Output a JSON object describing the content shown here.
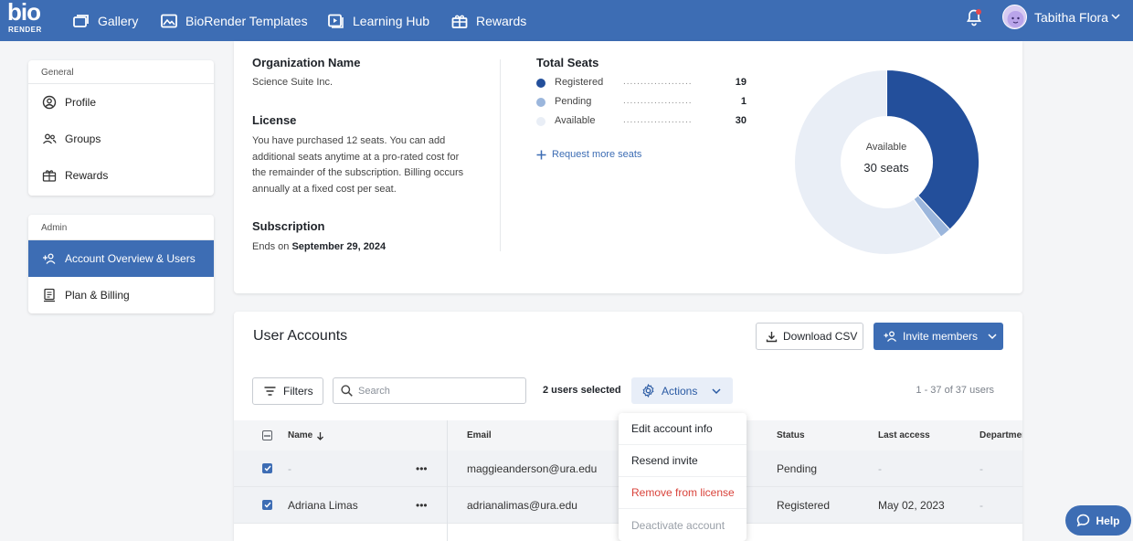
{
  "brand": {
    "logo_top": "bio",
    "logo_bottom": "RENDER"
  },
  "nav": {
    "items": [
      {
        "label": "Gallery",
        "icon": "gallery-icon"
      },
      {
        "label": "BioRender Templates",
        "icon": "image-icon"
      },
      {
        "label": "Learning Hub",
        "icon": "play-icon"
      },
      {
        "label": "Rewards",
        "icon": "gift-icon"
      }
    ],
    "user_name": "Tabitha Flora"
  },
  "sidebar": {
    "general": {
      "heading": "General",
      "items": [
        {
          "label": "Profile",
          "icon": "user-circle-icon"
        },
        {
          "label": "Groups",
          "icon": "groups-icon"
        },
        {
          "label": "Rewards",
          "icon": "gift-icon"
        }
      ]
    },
    "admin": {
      "heading": "Admin",
      "items": [
        {
          "label": "Account Overview & Users",
          "icon": "add-user-icon",
          "active": true
        },
        {
          "label": "Plan & Billing",
          "icon": "billing-icon"
        }
      ]
    }
  },
  "overview": {
    "org_heading": "Organization Name",
    "org_name": "Science Suite Inc.",
    "license_heading": "License",
    "license_text": "You have purchased 12 seats. You can add additional seats anytime at a pro-rated cost for the remainder of the subscription. Billing occurs annually at a fixed cost per seat.",
    "subscription_heading": "Subscription",
    "subscription_prefix": "Ends on",
    "subscription_date": "September 29, 2024",
    "seats_heading": "Total Seats",
    "seats": [
      {
        "label": "Registered",
        "value": 19,
        "color": "#234f9b"
      },
      {
        "label": "Pending",
        "value": 1,
        "color": "#9bb6dc"
      },
      {
        "label": "Available",
        "value": 30,
        "color": "#e9eef6"
      }
    ],
    "dot_leader": "....................",
    "request_label": "Request more seats",
    "donut_label": "Available",
    "donut_value": "30 seats"
  },
  "users": {
    "title": "User Accounts",
    "download_label": "Download CSV",
    "invite_label": "Invite members",
    "filters_label": "Filters",
    "search_placeholder": "Search",
    "selected_text": "2 users selected",
    "actions_label": "Actions",
    "range_text": "1 - 37 of 37 users",
    "columns": {
      "name": "Name",
      "email": "Email",
      "status": "Status",
      "last_access": "Last access",
      "department": "Departmen"
    },
    "rows": [
      {
        "name": "-",
        "email": "maggieanderson@ura.edu",
        "status": "Pending",
        "last_access": "-",
        "department": "-",
        "checked": true
      },
      {
        "name": "Adriana Limas",
        "email": "adrianalimas@ura.edu",
        "status": "Registered",
        "last_access": "May 02, 2023",
        "department": "-",
        "checked": true
      }
    ],
    "row_menu_glyph": "•••",
    "menu": [
      "Edit account info",
      "Resend invite",
      "Remove from license",
      "Deactivate account"
    ]
  },
  "help_label": "Help"
}
